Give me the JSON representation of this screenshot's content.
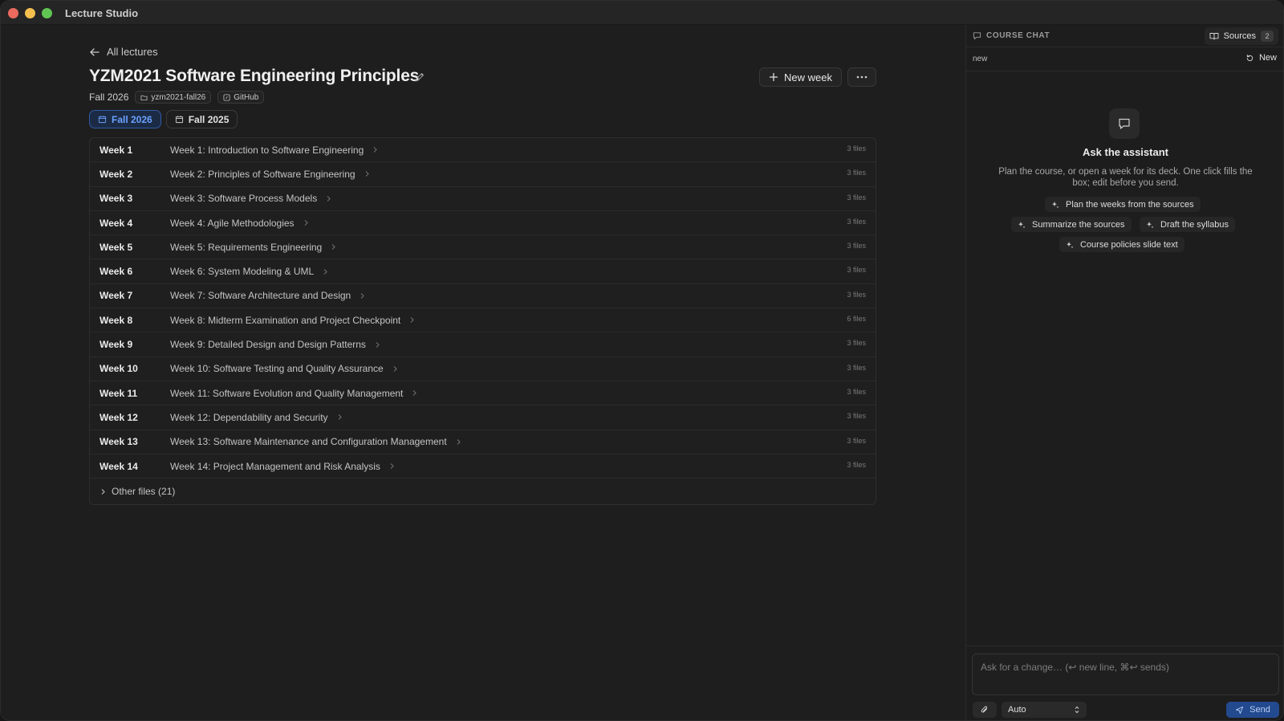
{
  "app": {
    "title": "Lecture Studio"
  },
  "header": {
    "back_label": "All lectures",
    "course_title": "YZM2021 Software Engineering Principles",
    "term": "Fall 2026",
    "slug_chip": "yzm2021-fall26",
    "github_chip": "GitHub",
    "new_week_label": "New week",
    "more_label": "···"
  },
  "term_tabs": [
    {
      "label": "Fall 2026",
      "active": true
    },
    {
      "label": "Fall 2025",
      "active": false
    }
  ],
  "weeks": [
    {
      "num": "Week 1",
      "title": "Week 1: Introduction to Software Engineering",
      "files": "3 files"
    },
    {
      "num": "Week 2",
      "title": "Week 2: Principles of Software Engineering",
      "files": "3 files"
    },
    {
      "num": "Week 3",
      "title": "Week 3: Software Process Models",
      "files": "3 files"
    },
    {
      "num": "Week 4",
      "title": "Week 4: Agile Methodologies",
      "files": "3 files"
    },
    {
      "num": "Week 5",
      "title": "Week 5: Requirements Engineering",
      "files": "3 files"
    },
    {
      "num": "Week 6",
      "title": "Week 6: System Modeling & UML",
      "files": "3 files"
    },
    {
      "num": "Week 7",
      "title": "Week 7: Software Architecture and Design",
      "files": "3 files"
    },
    {
      "num": "Week 8",
      "title": "Week 8: Midterm Examination and Project Checkpoint",
      "files": "6 files"
    },
    {
      "num": "Week 9",
      "title": "Week 9: Detailed Design and Design Patterns",
      "files": "3 files"
    },
    {
      "num": "Week 10",
      "title": "Week 10: Software Testing and Quality Assurance",
      "files": "3 files"
    },
    {
      "num": "Week 11",
      "title": "Week 11: Software Evolution and Quality Management",
      "files": "3 files"
    },
    {
      "num": "Week 12",
      "title": "Week 12: Dependability and Security",
      "files": "3 files"
    },
    {
      "num": "Week 13",
      "title": "Week 13: Software Maintenance and Configuration Management",
      "files": "3 files"
    },
    {
      "num": "Week 14",
      "title": "Week 14: Project Management and Risk Analysis",
      "files": "3 files"
    }
  ],
  "other_files_label": "Other files (21)",
  "chat": {
    "header_label": "COURSE CHAT",
    "sources_label": "Sources",
    "sources_count": "2",
    "session_name": "new",
    "new_label": "New",
    "ask_title": "Ask the assistant",
    "ask_description": "Plan the course, or open a week for its deck. One click fills the box; edit before you send.",
    "suggestions": [
      "Plan the weeks from the sources",
      "Summarize the sources",
      "Draft the syllabus",
      "Course policies slide text"
    ],
    "input_placeholder": "Ask for a change… (↩ new line, ⌘↩ sends)",
    "model_value": "Auto",
    "send_label": "Send"
  },
  "colors": {
    "accent": "#2f5aa5",
    "accent_text": "#6aa2ff",
    "send_bg": "#234a8f",
    "background": "#1e1e1e"
  },
  "icons": {
    "back": "arrow-left-icon",
    "edit": "pencil-icon",
    "folder": "folder-icon",
    "github": "github-icon",
    "calendar": "calendar-icon",
    "plus": "plus-icon",
    "more": "ellipsis-icon",
    "chevron": "chevron-right-icon",
    "chat": "chat-bubble-icon",
    "book": "book-icon",
    "refresh": "refresh-icon",
    "sparkle": "sparkle-icon",
    "paperclip": "paperclip-icon",
    "updown": "chevron-updown-icon",
    "send": "send-icon"
  }
}
